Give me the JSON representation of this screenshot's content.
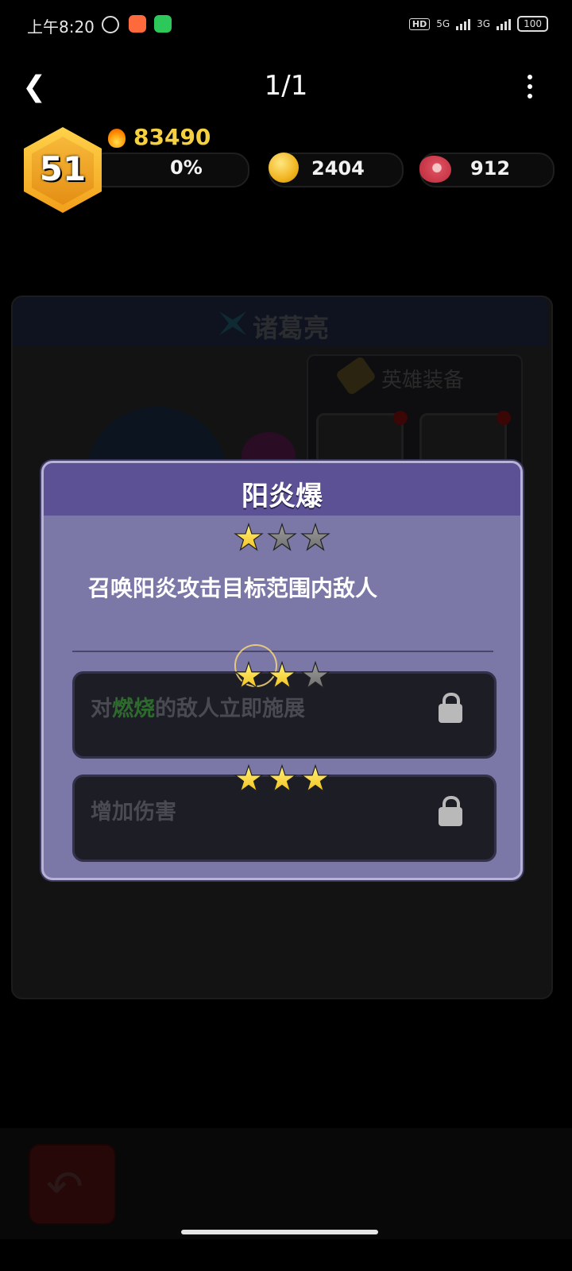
{
  "status_bar": {
    "time": "上午8:20",
    "signal_labels": [
      "5G",
      "3G"
    ],
    "battery": "100",
    "hd_label": "HD"
  },
  "nav": {
    "page_indicator": "1/1"
  },
  "resources": {
    "level": "51",
    "power": "83490",
    "xp_percent": "0%",
    "coins": "2404",
    "meat": "912"
  },
  "background": {
    "hero_name": "诸葛亮",
    "equipment_title": "英雄装备"
  },
  "skill_modal": {
    "title": "阳炎爆",
    "current_stars": 1,
    "max_stars": 3,
    "description": "召唤阳炎攻击目标范围内敌人",
    "upgrades": [
      {
        "stars": 2,
        "text_before": "对",
        "highlight": "燃烧",
        "text_after": "的敌人立即施展",
        "locked": true
      },
      {
        "stars": 3,
        "text": "增加伤害",
        "locked": true
      }
    ],
    "highlight_color": "#2e6a2e"
  },
  "colors": {
    "modal_bg": "#7b78a8",
    "modal_header": "#5d5196",
    "star_on": "#f3c11a",
    "score_yellow": "#f5d142"
  }
}
